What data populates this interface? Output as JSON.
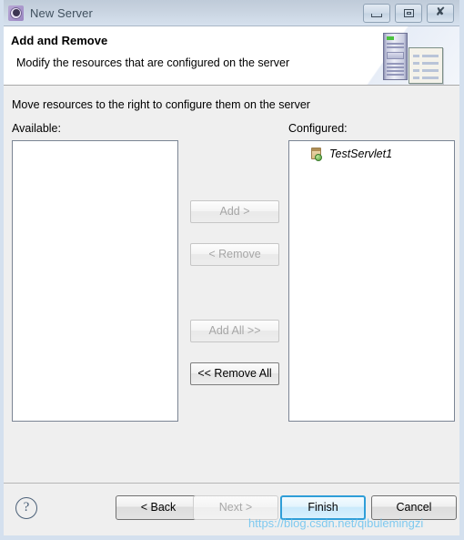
{
  "window": {
    "title": "New Server",
    "app_icon": "server-gear-icon",
    "controls": [
      {
        "name": "minimize",
        "label": "–",
        "icon": "minimize-icon"
      },
      {
        "name": "restore",
        "label": "□",
        "icon": "restore-icon"
      },
      {
        "name": "close",
        "label": "✕",
        "icon": "close-icon"
      }
    ]
  },
  "header": {
    "title": "Add and Remove",
    "subtitle": "Modify the resources that are configured on the server",
    "graphic": "server-and-document-icon"
  },
  "main": {
    "instruction": "Move resources to the right to configure them on the server",
    "available": {
      "label": "Available:",
      "items": []
    },
    "configured": {
      "label": "Configured:",
      "items": [
        {
          "label": "TestServlet1",
          "icon": "web-module-icon"
        }
      ]
    },
    "transfer_buttons": [
      {
        "label": "Add >",
        "enabled": false
      },
      {
        "label": "< Remove",
        "enabled": false
      },
      {
        "label": "Add All >>",
        "enabled": false
      },
      {
        "label": "<< Remove All",
        "enabled": true
      }
    ]
  },
  "footer": {
    "help_icon": "question-mark-icon",
    "buttons": [
      {
        "label": "< Back",
        "state": "normal"
      },
      {
        "label": "Next >",
        "state": "disabled"
      },
      {
        "label": "Finish",
        "state": "default"
      },
      {
        "label": "Cancel",
        "state": "normal"
      }
    ]
  },
  "watermark": "https://blog.csdn.net/qibulemingzi",
  "colors": {
    "titlebar_top": "#bfcbd9",
    "titlebar_bottom": "#d6e1ee",
    "window_border": "#d4e0ee",
    "body_background": "#efefef",
    "default_button_border": "#2f9ed8",
    "watermark": "#59bdf0",
    "module_globe": "#4f9e3b"
  }
}
